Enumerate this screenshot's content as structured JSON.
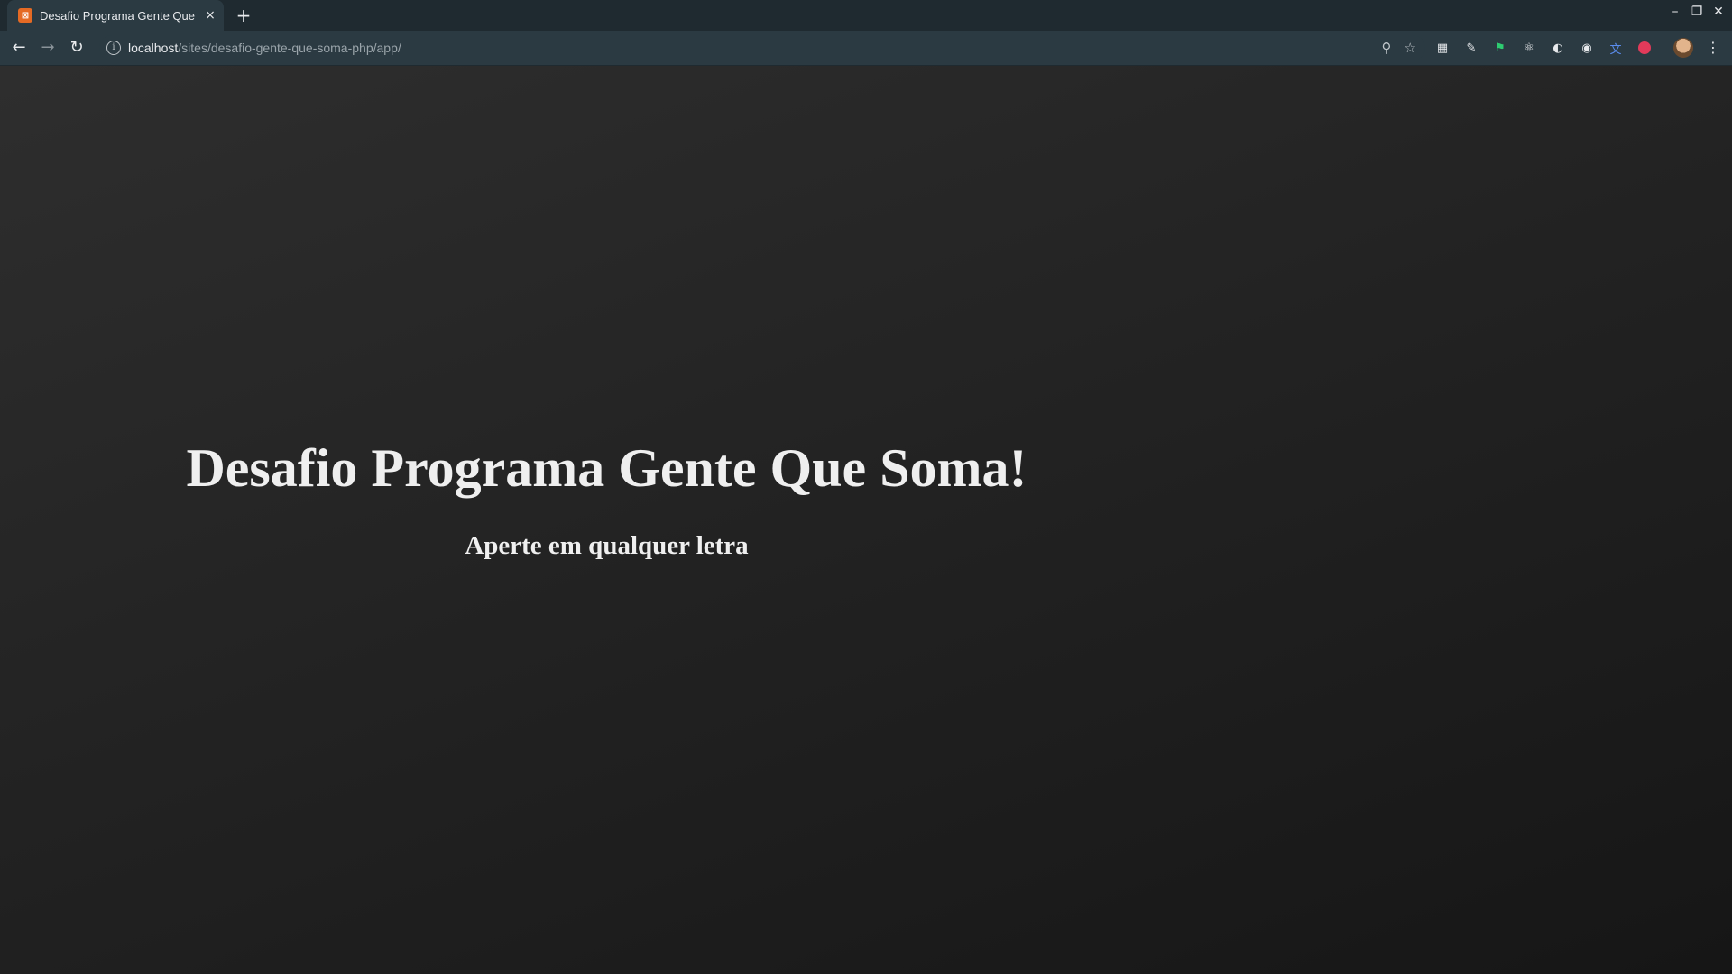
{
  "browser": {
    "tab": {
      "title": "Desafio Programa Gente Que Soma!",
      "favicon": "xampp-icon",
      "close_glyph": "×"
    },
    "new_tab_glyph": "+",
    "url": {
      "host": "localhost",
      "path": "/sites/desafio-gente-que-soma-php/app/"
    },
    "extensions": [
      "extension-1-icon",
      "extension-2-icon",
      "extension-3-icon",
      "extension-4-icon",
      "extension-5-icon",
      "extension-6-icon",
      "extension-7-icon",
      "extension-8-icon"
    ],
    "window_controls": {
      "minimize": "–",
      "restore": "❐",
      "close": "✕"
    }
  },
  "page": {
    "title": "Desafio Programa Gente Que Soma!",
    "subtitle": "Aperte em qualquer letra"
  },
  "colors": {
    "chrome_dark": "#1f2a30",
    "chrome": "#2b3a42",
    "text": "#efefef",
    "favicon": "#e56a24",
    "extension_badge": "#e23a5a"
  }
}
